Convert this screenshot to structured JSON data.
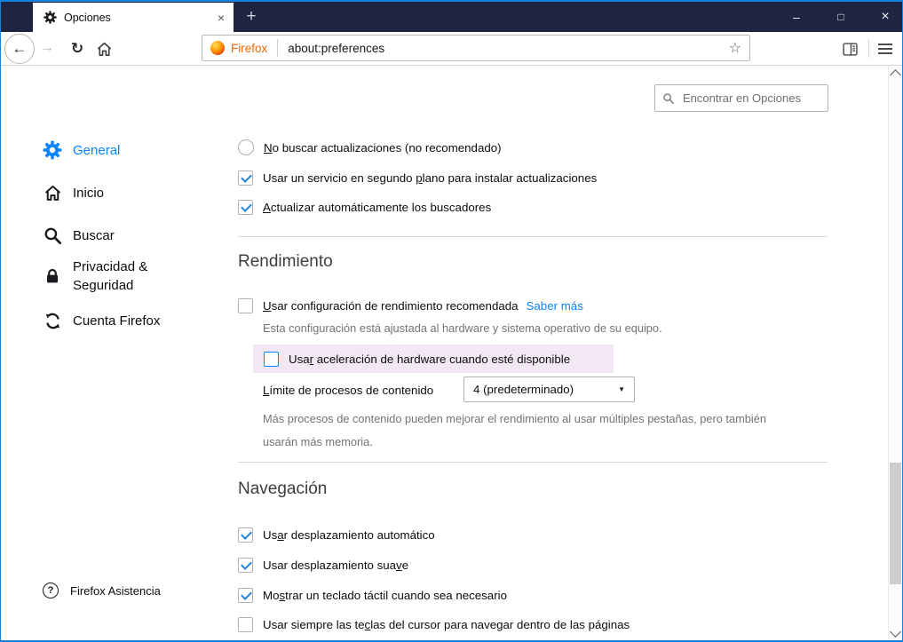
{
  "window": {
    "tab": {
      "title": "Opciones"
    },
    "tab_close_label": "×",
    "new_tab_label": "+",
    "controls": {
      "minimize": "–",
      "maximize": "□",
      "close": "×"
    }
  },
  "toolbar": {
    "back_glyph": "←",
    "forward_glyph": "→",
    "reload_glyph": "↻",
    "urlbar": {
      "brand": "Firefox",
      "url": "about:preferences",
      "star_glyph": "☆"
    }
  },
  "search": {
    "placeholder": "Encontrar en Opciones"
  },
  "sidebar": {
    "items": [
      {
        "label": "General"
      },
      {
        "label": "Inicio"
      },
      {
        "label": "Buscar"
      },
      {
        "label": "Privacidad & Seguridad"
      },
      {
        "label": "Cuenta Firefox"
      }
    ],
    "footer": {
      "label": "Firefox Asistencia",
      "icon_glyph": "?"
    }
  },
  "main": {
    "updates": {
      "no_check": {
        "pre": "",
        "key": "N",
        "post": "o buscar actualizaciones (no recomendado)"
      },
      "bg_service": {
        "pre": "Usar un servicio en segundo ",
        "key": "p",
        "post": "lano para instalar actualizaciones"
      },
      "auto_search": {
        "pre": "",
        "key": "A",
        "post": "ctualizar automáticamente los buscadores"
      }
    },
    "performance": {
      "title": "Rendimiento",
      "recommended": {
        "pre": "",
        "key": "U",
        "post": "sar configuración de rendimiento recomendada"
      },
      "learn_more": "Saber más",
      "description": "Esta configuración está ajustada al hardware y sistema operativo de su equipo.",
      "hw_accel": {
        "pre": "Usa",
        "key": "r",
        "post": " aceleración de hardware cuando esté disponible"
      },
      "process_limit": {
        "pre": "",
        "key": "L",
        "post": "ímite de procesos de contenido"
      },
      "process_value": "4 (predeterminado)",
      "caret_glyph": "▼",
      "process_note_lines": [
        "Más procesos de contenido pueden mejorar el rendimiento al usar múltiples pestañas, pero también",
        "usarán más memoria."
      ]
    },
    "browsing": {
      "title": "Navegación",
      "auto_scroll": {
        "pre": "Us",
        "key": "a",
        "post": "r desplazamiento automático"
      },
      "smooth_scroll": {
        "pre": "Usar desplazamiento sua",
        "key": "v",
        "post": "e"
      },
      "touch_keyboard": {
        "pre": "Mo",
        "key": "s",
        "post": "trar un teclado táctil cuando sea necesario"
      },
      "cursor_keys": {
        "pre": "Usar siempre las te",
        "key": "c",
        "post": "las del cursor para navegar dentro de las páginas"
      }
    }
  },
  "colors": {
    "window_border": "#1781dd",
    "titlebar_bg": "#1f2540",
    "accent_blue": "#0a84ff",
    "check_blue": "#2584d8",
    "highlight_bg": "#f2e8f3",
    "link": "#0a84ff",
    "brand_orange": "#e8680e"
  }
}
